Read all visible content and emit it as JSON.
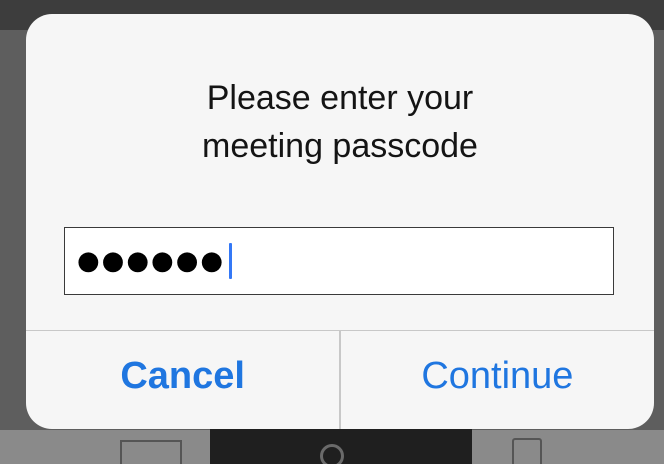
{
  "dialog": {
    "title": "Please enter your\nmeeting passcode",
    "passcode": {
      "masked_value": "●●●●●●",
      "character_count": 6
    },
    "buttons": {
      "cancel_label": "Cancel",
      "continue_label": "Continue"
    }
  },
  "colors": {
    "accent": "#1f76e0",
    "caret": "#3478f6",
    "dialog_background": "#f6f6f6"
  }
}
